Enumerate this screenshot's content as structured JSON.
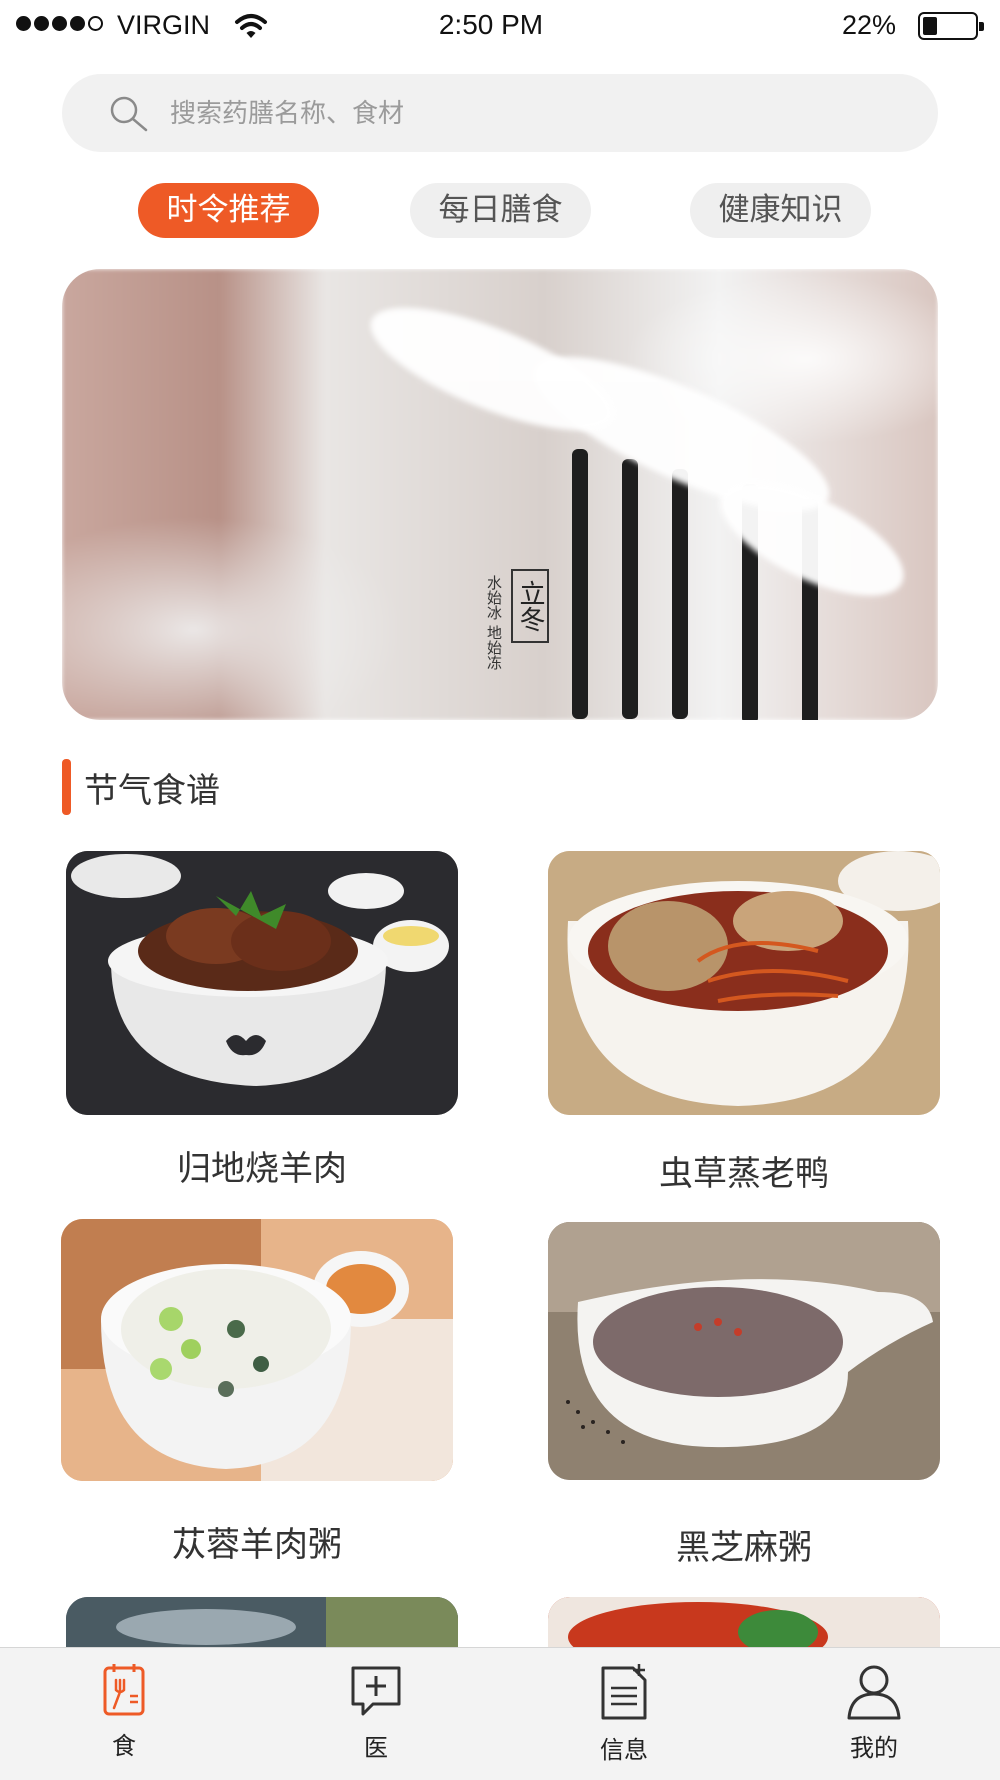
{
  "status_bar": {
    "carrier": "VIRGIN",
    "time": "2:50 PM",
    "battery_percent": "22%",
    "battery_level": 0.22,
    "signal_dots": 5,
    "signal_filled": 4
  },
  "search": {
    "placeholder": "搜索药膳名称、食材",
    "icon": "search-icon"
  },
  "tabs": [
    {
      "label": "时令推荐",
      "active": true
    },
    {
      "label": "每日膳食",
      "active": false
    },
    {
      "label": "健康知识",
      "active": false
    }
  ],
  "banner": {
    "seal_text": "立冬",
    "poem_text": "水始冰 地始冻"
  },
  "section": {
    "title": "节气食谱"
  },
  "recipes": [
    {
      "name": "归地烧羊肉"
    },
    {
      "name": "虫草蒸老鸭"
    },
    {
      "name": "苁蓉羊肉粥"
    },
    {
      "name": "黑芝麻粥"
    }
  ],
  "nav": [
    {
      "label": "食",
      "icon": "food-calendar-icon",
      "active": true
    },
    {
      "label": "医",
      "icon": "medical-chat-icon",
      "active": false
    },
    {
      "label": "信息",
      "icon": "document-icon",
      "active": false
    },
    {
      "label": "我的",
      "icon": "user-icon",
      "active": false
    }
  ],
  "colors": {
    "accent": "#ee5a26",
    "tab_inactive_bg": "#efefef",
    "search_bg": "#f1f1f1",
    "nav_bg": "#f3f3f3"
  }
}
